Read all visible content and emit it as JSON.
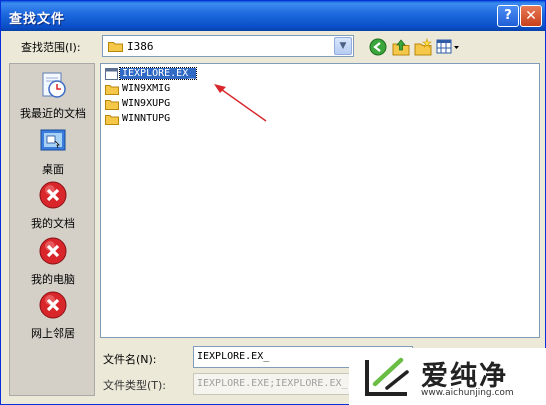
{
  "window": {
    "title": "查找文件",
    "help_label": "?",
    "close_label": "✕"
  },
  "toolbar": {
    "look_in_label": "查找范围(I):",
    "look_in_value": "I386",
    "dropdown_arrow": "▼",
    "icons": [
      "back-icon",
      "up-folder-icon",
      "new-folder-icon",
      "view-menu-icon"
    ]
  },
  "places": [
    {
      "label": "我最近的文档",
      "icon": "recent-documents-icon"
    },
    {
      "label": "桌面",
      "icon": "desktop-icon"
    },
    {
      "label": "我的文档",
      "icon": "error-icon"
    },
    {
      "label": "我的电脑",
      "icon": "error-icon"
    },
    {
      "label": "网上邻居",
      "icon": "error-icon"
    }
  ],
  "files": [
    {
      "name": "IEXPLORE.EX_",
      "type": "file",
      "selected": true
    },
    {
      "name": "WIN9XMIG",
      "type": "folder",
      "selected": false
    },
    {
      "name": "WIN9XUPG",
      "type": "folder",
      "selected": false
    },
    {
      "name": "WINNTUPG",
      "type": "folder",
      "selected": false
    }
  ],
  "form": {
    "filename_label": "文件名(N):",
    "filename_value": "IEXPLORE.EX_",
    "filetype_label": "文件类型(T):",
    "filetype_value": "IEXPLORE.EXE;IEXPLORE.EX_"
  },
  "watermark": {
    "name": "爱纯净",
    "url": "www.aichunjing.com"
  },
  "colors": {
    "title_bar": "#0A5FD8",
    "selection": "#316AC5",
    "annotation_arrow": "#D8262B",
    "folder": "#F5C84A",
    "error": "#D8262B"
  }
}
